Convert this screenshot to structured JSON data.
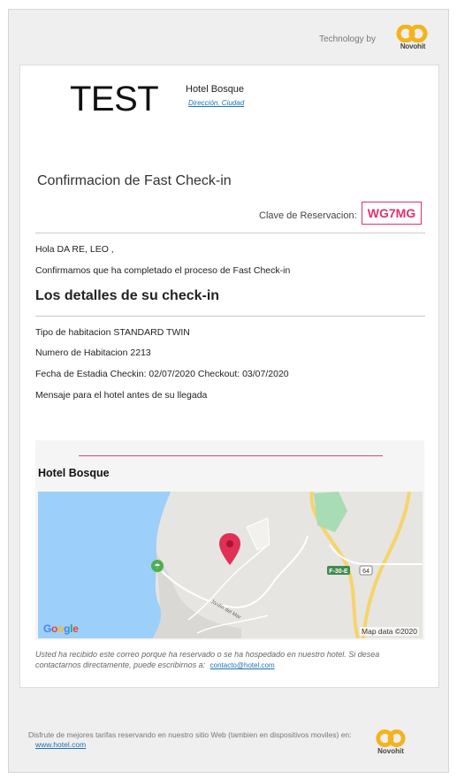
{
  "header": {
    "technology_by": "Technology by",
    "brand_name": "Novohit"
  },
  "hotel": {
    "logo_text": "TEST",
    "name": "Hotel Bosque",
    "address": "Dirección, Ciudad"
  },
  "confirmation": {
    "title": "Confirmacion de Fast Check-in",
    "clave_label": "Clave de Reservacion:",
    "clave_code": "WG7MG",
    "greeting": "Hola DA RE, LEO ,",
    "message": "Confirmamos que ha completado el proceso de Fast Check-in"
  },
  "details": {
    "title": "Los detalles de su check-in",
    "room_type": "Tipo de habitacion STANDARD TWIN",
    "room_number": "Numero de Habitacion 2213",
    "stay_dates": "Fecha de Estadia Checkin: 02/07/2020 Checkout: 03/07/2020",
    "hotel_message": "Mensaje para el hotel antes de su llegada"
  },
  "map": {
    "hotel_name": "Hotel Bosque",
    "google_logo": "Google",
    "map_data": "Map data ©2020",
    "road_label_1": "F-30-E",
    "road_label_2": "64",
    "street_label": "Jardín del Mar"
  },
  "disclaimer": {
    "text": "Usted ha recibido este correo porque ha reservado o se ha hospedado en nuestro hotel. Si desea contactarnos directamente, puede escribirnos a:",
    "email": "contacto@hotel.com"
  },
  "footer": {
    "text": "Disfrute de mejores tarifas reservando en nuestro sitio Web (tambien en dispositivos moviles) en:",
    "link": "www.hotel.com",
    "brand_name": "Novohit"
  },
  "colors": {
    "accent": "#e2306c",
    "link": "#1a73b8",
    "brand_orange": "#f5b21b",
    "water": "#9ccffa"
  }
}
